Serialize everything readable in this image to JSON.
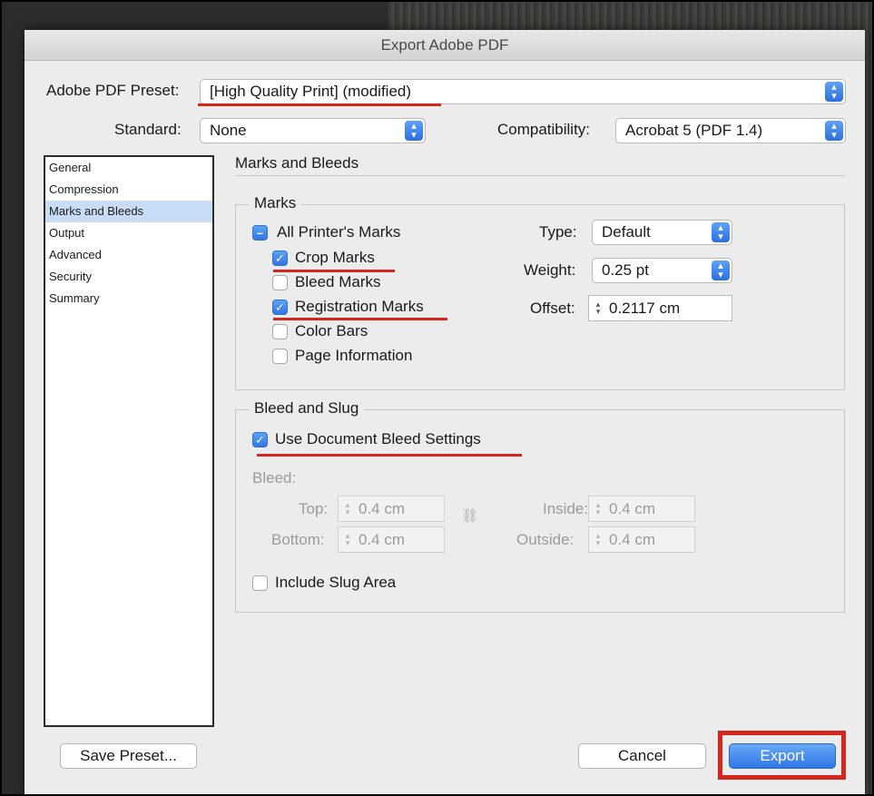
{
  "dialog": {
    "title": "Export Adobe PDF"
  },
  "header": {
    "preset_label": "Adobe PDF Preset:",
    "preset_value": "[High Quality Print] (modified)",
    "standard_label": "Standard:",
    "standard_value": "None",
    "compat_label": "Compatibility:",
    "compat_value": "Acrobat 5 (PDF 1.4)"
  },
  "sidebar": {
    "items": [
      {
        "label": "General"
      },
      {
        "label": "Compression"
      },
      {
        "label": "Marks and Bleeds",
        "selected": true
      },
      {
        "label": "Output"
      },
      {
        "label": "Advanced"
      },
      {
        "label": "Security"
      },
      {
        "label": "Summary"
      }
    ]
  },
  "panel": {
    "title": "Marks and Bleeds",
    "marks": {
      "group_title": "Marks",
      "all_printers_marks": {
        "label": "All Printer's Marks",
        "state": "mixed"
      },
      "crop_marks": {
        "label": "Crop Marks",
        "checked": true
      },
      "bleed_marks": {
        "label": "Bleed Marks",
        "checked": false
      },
      "registration_marks": {
        "label": "Registration Marks",
        "checked": true
      },
      "color_bars": {
        "label": "Color Bars",
        "checked": false
      },
      "page_information": {
        "label": "Page Information",
        "checked": false
      },
      "type_label": "Type:",
      "type_value": "Default",
      "weight_label": "Weight:",
      "weight_value": "0.25 pt",
      "offset_label": "Offset:",
      "offset_value": "0.2117 cm"
    },
    "bleed": {
      "group_title": "Bleed and Slug",
      "use_doc_bleed": {
        "label": "Use Document Bleed Settings",
        "checked": true
      },
      "bleed_label": "Bleed:",
      "top_label": "Top:",
      "top_value": "0.4 cm",
      "bottom_label": "Bottom:",
      "bottom_value": "0.4 cm",
      "inside_label": "Inside:",
      "inside_value": "0.4 cm",
      "outside_label": "Outside:",
      "outside_value": "0.4 cm",
      "include_slug": {
        "label": "Include Slug Area",
        "checked": false
      }
    }
  },
  "footer": {
    "save_preset": "Save Preset...",
    "cancel": "Cancel",
    "export": "Export"
  },
  "colors": {
    "annotation_red": "#d4251e",
    "accent_blue": "#2f76e6"
  }
}
